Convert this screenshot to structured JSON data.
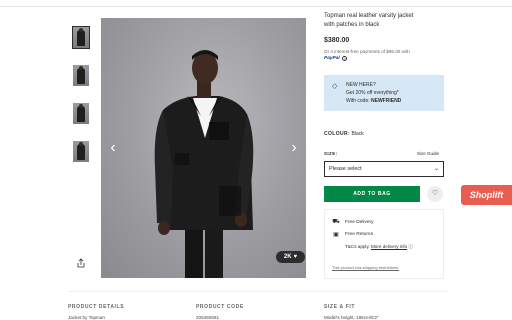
{
  "product": {
    "title_line1": "Topman real leather varsity jacket",
    "title_line2": "with patches in black",
    "price": "$380.00",
    "installment": "Or 4 interest-free payments of $95.00 with",
    "paypal_label": "PayPal",
    "likes": "2K"
  },
  "promo": {
    "badge": "NEW HERE?",
    "offer": "Get 20% off everything*",
    "code_prefix": "With code:",
    "code": "NEWFRIEND"
  },
  "colour": {
    "label": "COLOUR:",
    "value": "Black"
  },
  "size": {
    "label": "SIZE:",
    "chart_link": "Size Guide",
    "selected": "Please select"
  },
  "actions": {
    "add_to_bag": "ADD TO BAG"
  },
  "delivery": {
    "free_delivery": "Free Delivery",
    "free_returns": "Free Returns",
    "terms": "T&Cs apply.",
    "more_info": "More delivery info",
    "footnote": "This product has shipping restrictions."
  },
  "shoplift": {
    "label": "Shoplift"
  },
  "footer": {
    "details_title": "PRODUCT DETAILS",
    "details_value": "Jacket by Topman",
    "code_title": "PRODUCT CODE",
    "code_value": "205450591",
    "fit_title": "SIZE & FIT",
    "fit_value": "Model's height: 188cm/6'2\""
  },
  "colors": {
    "add_button": "#018849",
    "promo_bg": "#d6e7f6",
    "shoplift": "#e85d4f"
  }
}
